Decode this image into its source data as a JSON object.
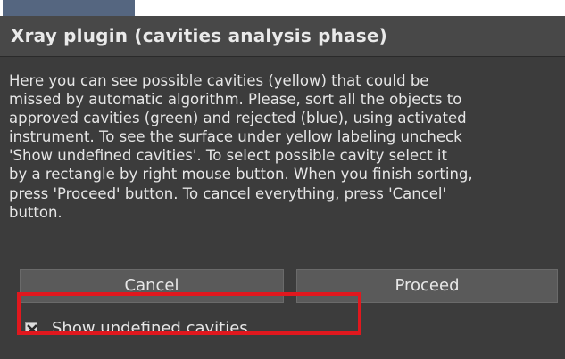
{
  "dialog": {
    "title": "Xray plugin (cavities analysis phase)",
    "description_lines": [
      "Here you can see possible cavities (yellow) that could be",
      "missed by automatic algorithm. Please, sort all the objects to",
      "approved cavities (green) and rejected (blue), using activated",
      "instrument. To see the surface under yellow labeling uncheck",
      "'Show undefined cavities'. To select possible cavity select it",
      "by a rectangle by right mouse button. When you finish sorting,",
      "press 'Proceed' button. To cancel everything, press 'Cancel'",
      "button."
    ],
    "cancel_label": "Cancel",
    "proceed_label": "Proceed",
    "checkbox": {
      "label": "Show undefined cavities",
      "checked": true
    }
  },
  "colors": {
    "panel_bg": "#3c3c3c",
    "title_bg": "#484848",
    "button_bg": "#5a5a5a",
    "highlight": "#e0181e",
    "top_tab": "#556680"
  },
  "icons": {
    "checkbox_mark": "check-x-icon"
  }
}
